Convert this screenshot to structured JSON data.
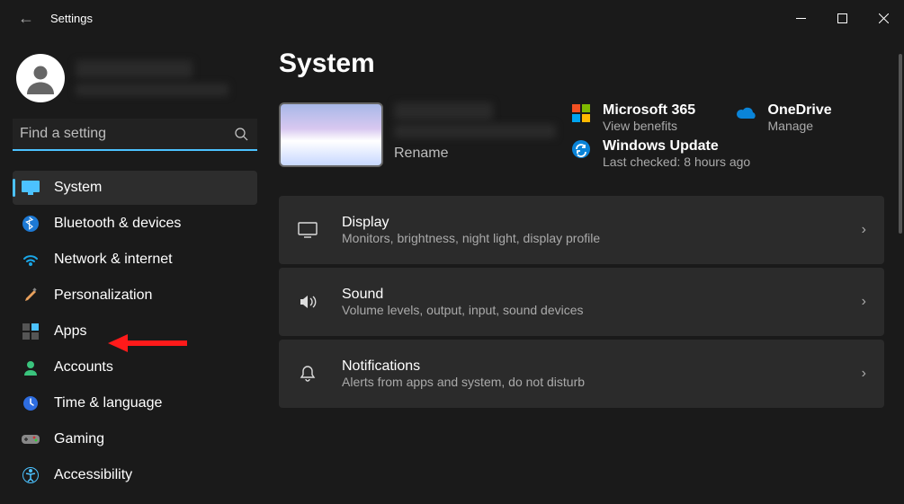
{
  "window": {
    "title": "Settings",
    "tooltip_minimize": "Minimize",
    "tooltip_maximize": "Maximize",
    "tooltip_close": "Close"
  },
  "search": {
    "placeholder": "Find a setting"
  },
  "sidebar": {
    "items": [
      {
        "label": "System"
      },
      {
        "label": "Bluetooth & devices"
      },
      {
        "label": "Network & internet"
      },
      {
        "label": "Personalization"
      },
      {
        "label": "Apps"
      },
      {
        "label": "Accounts"
      },
      {
        "label": "Time & language"
      },
      {
        "label": "Gaming"
      },
      {
        "label": "Accessibility"
      }
    ]
  },
  "page": {
    "title": "System",
    "rename_label": "Rename"
  },
  "quick": {
    "ms365": {
      "title": "Microsoft 365",
      "sub": "View benefits"
    },
    "onedrive": {
      "title": "OneDrive",
      "sub": "Manage"
    },
    "update": {
      "title": "Windows Update",
      "sub": "Last checked: 8 hours ago"
    }
  },
  "settings": [
    {
      "title": "Display",
      "sub": "Monitors, brightness, night light, display profile"
    },
    {
      "title": "Sound",
      "sub": "Volume levels, output, input, sound devices"
    },
    {
      "title": "Notifications",
      "sub": "Alerts from apps and system, do not disturb"
    }
  ]
}
